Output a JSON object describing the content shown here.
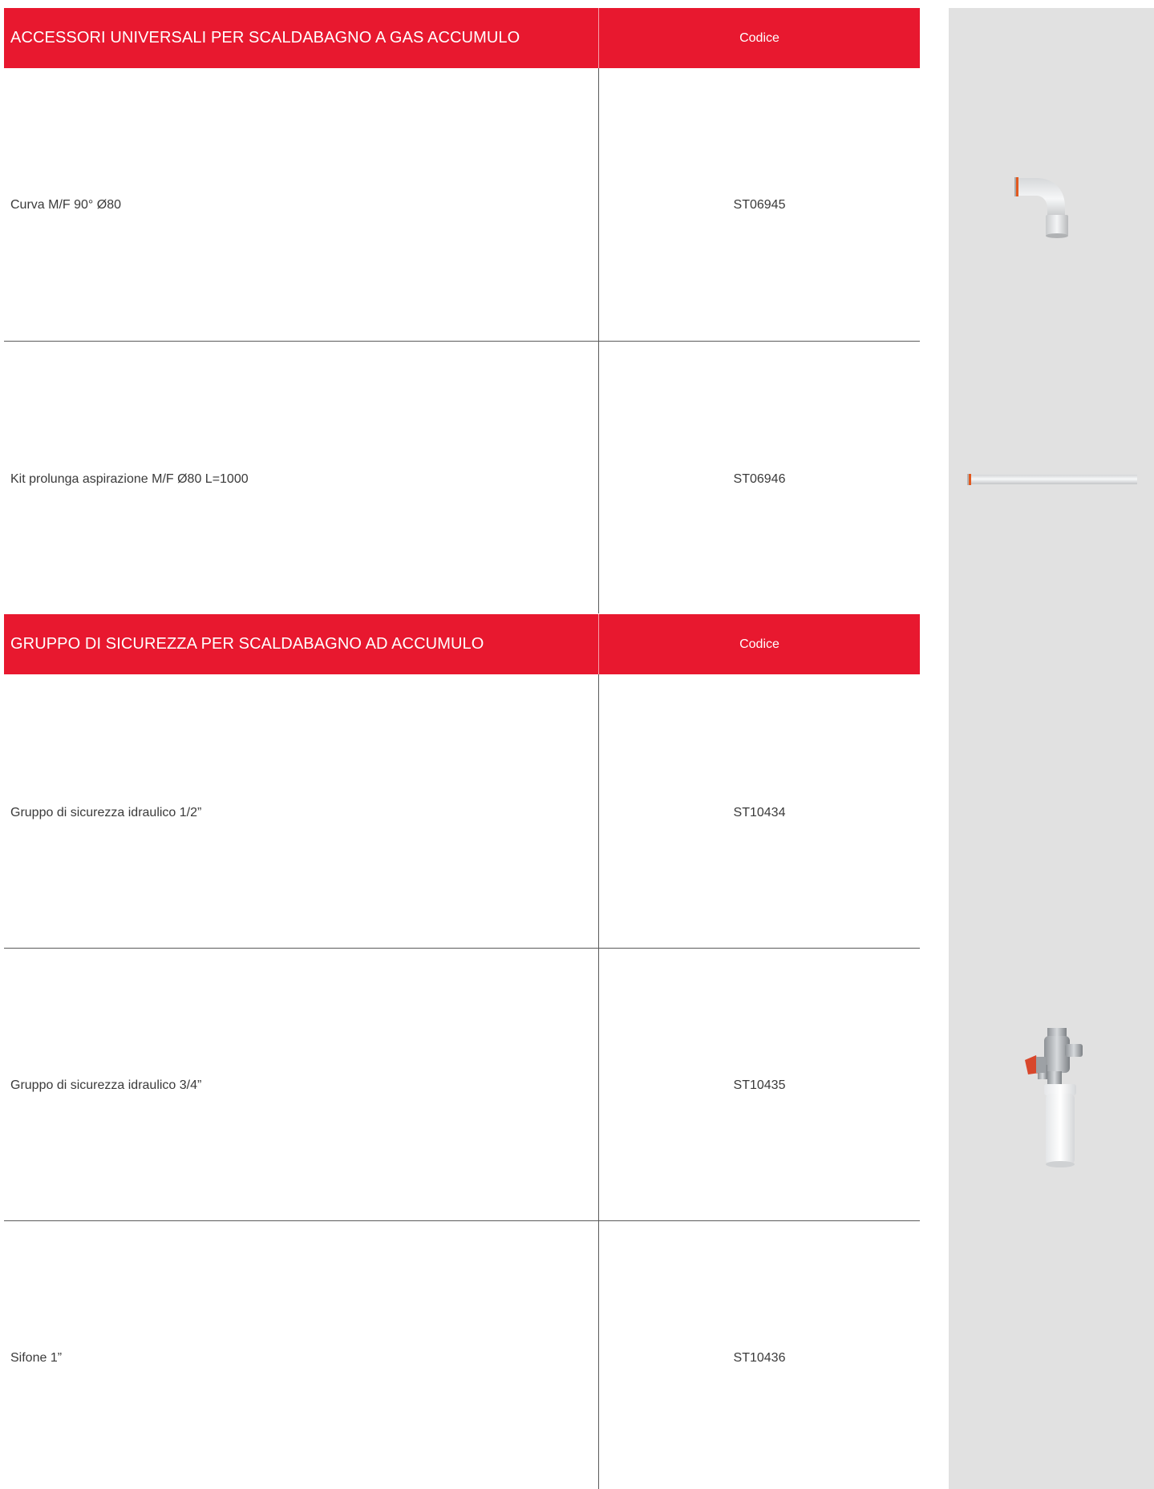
{
  "sections": [
    {
      "title": "ACCESSORI UNIVERSALI PER SCALDABAGNO A GAS ACCUMULO",
      "code_header": "Codice",
      "rows": [
        {
          "label": "Curva M/F 90° Ø80",
          "code": "ST06945"
        },
        {
          "label": "Kit prolunga aspirazione M/F Ø80 L=1000",
          "code": "ST06946"
        }
      ]
    },
    {
      "title": "GRUPPO DI SICUREZZA PER SCALDABAGNO AD ACCUMULO",
      "code_header": "Codice",
      "rows": [
        {
          "label": "Gruppo di sicurezza idraulico 1/2”",
          "code": "ST10434"
        },
        {
          "label": "Gruppo di sicurezza idraulico 3/4”",
          "code": "ST10435"
        },
        {
          "label": "Sifone 1”",
          "code": "ST10436"
        }
      ]
    }
  ],
  "colors": {
    "header_red": "#e8182f",
    "side_panel": "#e1e1e1",
    "rule": "#5a5a5a"
  },
  "product_images": [
    "elbow-pipe-image",
    "extension-pipe-image",
    "safety-valve-image"
  ]
}
